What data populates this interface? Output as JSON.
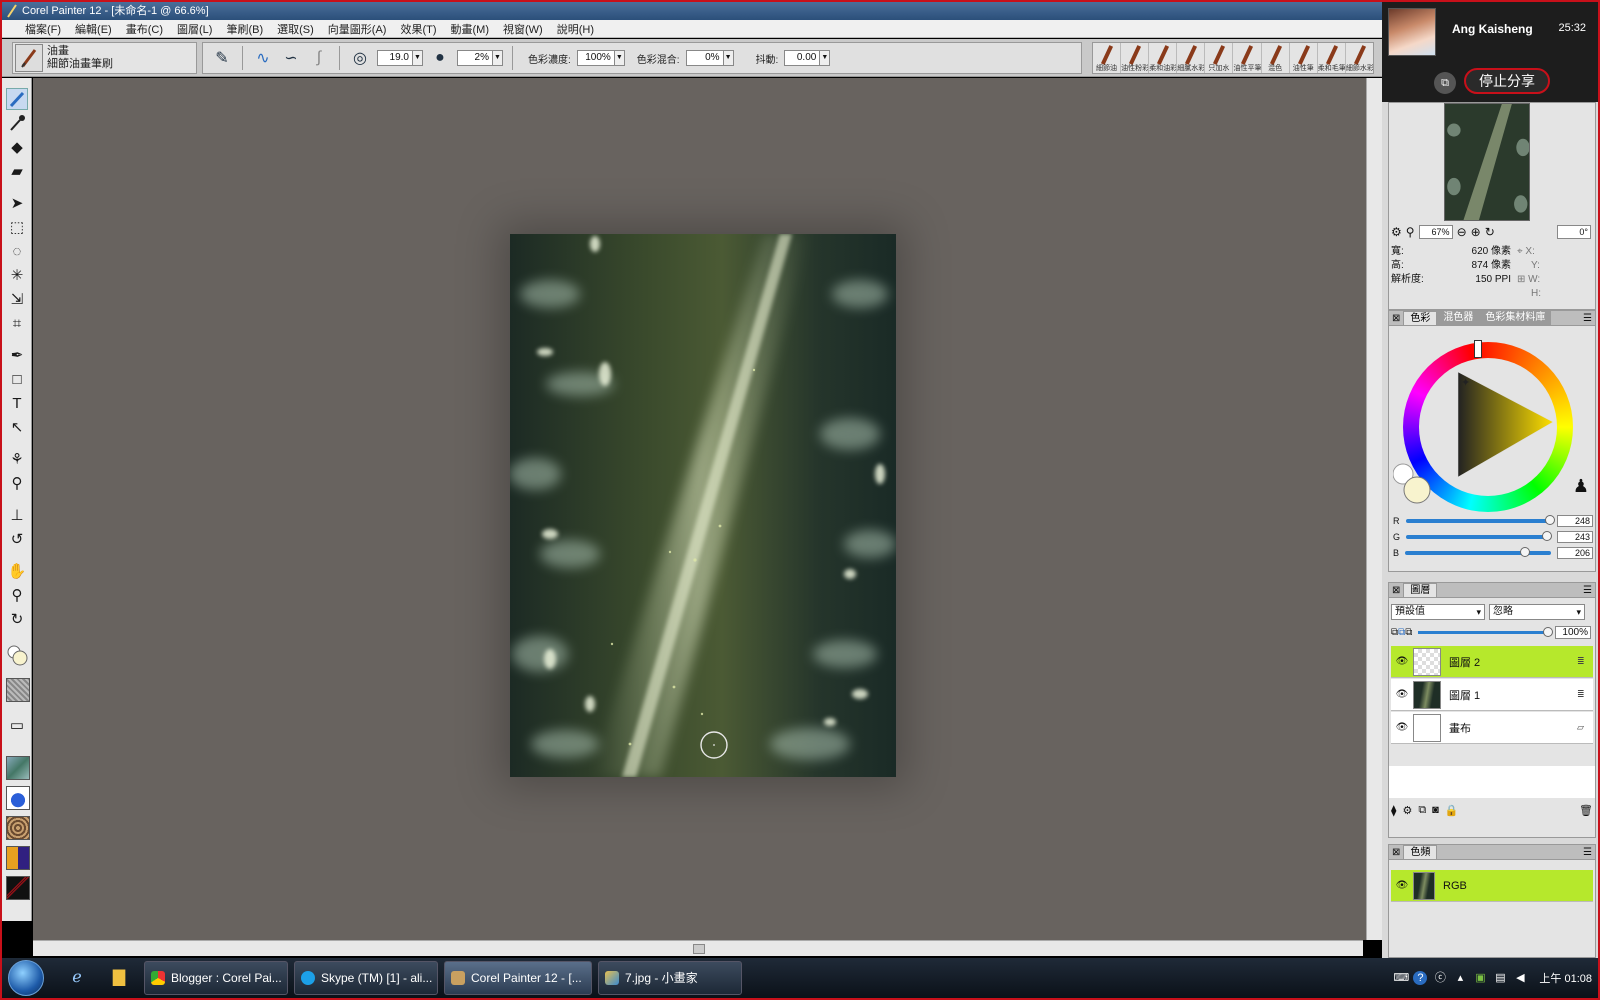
{
  "window": {
    "title": "Corel Painter 12 - [未命名-1 @ 66.6%]"
  },
  "menu": [
    "檔案(F)",
    "編輯(E)",
    "畫布(C)",
    "圖層(L)",
    "筆刷(B)",
    "選取(S)",
    "向量圖形(A)",
    "效果(T)",
    "動畫(M)",
    "視窗(W)",
    "說明(H)"
  ],
  "propbar": {
    "brush_category": "油畫",
    "brush_variant": "細節油畫筆刷",
    "size_value": "19.0",
    "opacity_value": "2%",
    "color_concentration_label": "色彩濃度:",
    "color_concentration_value": "100%",
    "color_blend_label": "色彩混合:",
    "color_blend_value": "0%",
    "jitter_label": "抖動:",
    "jitter_value": "0.00"
  },
  "brush_strip": [
    "細節油",
    "油性粉彩",
    "柔和油彩",
    "細膩水彩",
    "只加水",
    "油性平筆",
    "混色",
    "油性筆",
    "柔和毛筆",
    "細節水彩"
  ],
  "share": {
    "user_name": "Ang Kaisheng",
    "timer": "25:32",
    "stop_label": "停止分享"
  },
  "navigator": {
    "zoom": "67%",
    "rotation": "0°",
    "width_label": "寬:",
    "width_value": "620 像素",
    "height_label": "高:",
    "height_value": "874 像素",
    "resolution_label": "解析度:",
    "resolution_value": "150 PPI",
    "x_label": "X:",
    "y_label": "Y:",
    "w_label": "W:",
    "h_label": "H:"
  },
  "color_panel": {
    "tabs": [
      "色彩",
      "混色器",
      "色彩集材料庫"
    ],
    "r": "248",
    "g": "243",
    "b": "206",
    "r_label": "R",
    "g_label": "G",
    "b_label": "B",
    "current_color": "#f8f3ce"
  },
  "layers_panel": {
    "tab": "圖層",
    "composite_method": "預設值",
    "composite_depth": "忽略",
    "opacity": "100%",
    "layers": [
      {
        "name": "圖層 2",
        "selected": true
      },
      {
        "name": "圖層 1",
        "selected": false
      },
      {
        "name": "畫布",
        "selected": false
      }
    ]
  },
  "channels_panel": {
    "tab": "色頻",
    "channel": "RGB"
  },
  "taskbar": {
    "tasks": [
      {
        "label": "Blogger : Corel Pai..."
      },
      {
        "label": "Skype (TM) [1] - ali..."
      },
      {
        "label": "Corel Painter 12 - [..."
      },
      {
        "label": "7.jpg - 小畫家"
      }
    ],
    "clock": "上午 01:08"
  },
  "colors": {
    "selection_green": "#b6e82c",
    "accent_red": "#c8101a",
    "workspace_gray": "#68635f"
  }
}
